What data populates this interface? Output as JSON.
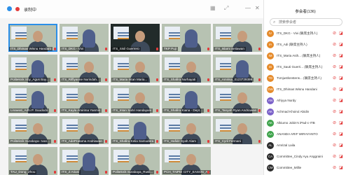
{
  "window": {
    "title": "录制中",
    "minimize": "—",
    "close": "✕"
  },
  "panel": {
    "title": "参会者(136)",
    "search_placeholder": "搜索参会者"
  },
  "tiles": [
    {
      "name": "ITS_Dhimas Wisnu Handani"
    },
    {
      "name": "ITS_DKG - Vivi"
    },
    {
      "name": "ITS_Sisil Guerrero"
    },
    {
      "name": "TKP Puji"
    },
    {
      "name": "ITS_Islami Setiawan"
    },
    {
      "name": "Politeknik Sby_Agus Bay..."
    },
    {
      "name": "ITS_Riffiyanne Nurindah..."
    },
    {
      "name": "ITS_Maria Intan Maria..."
    },
    {
      "name": "ITS_Shafira Nurhayati"
    },
    {
      "name": "ITS_Amirisa_0123729399"
    },
    {
      "name": "Linawati_Adhi P. Suudodo"
    },
    {
      "name": "ITS_Kayla Amirima Yasmin"
    },
    {
      "name": "ITS_Intan Sahri Handayani"
    },
    {
      "name": "ITS_Shafira Kiana - Dept..."
    },
    {
      "name": "ITS_Tanyah Ryan Andriawan"
    },
    {
      "name": "Politeknik Surabaya- Ivan..."
    },
    {
      "name": "ITS_AdePratama Andriawan"
    },
    {
      "name": "ITS_Shafira Kelia Samudera"
    },
    {
      "name": "ITS_Hafidz Syah Alam"
    },
    {
      "name": "ITS_Cyril Fermani"
    },
    {
      "name": "TAU_Dong_Zhou"
    },
    {
      "name": "ITS_Z Ariani"
    },
    {
      "name": "Politeknik Surabaya_Rusli..."
    },
    {
      "name": "PCH_TAIPEI CITY_EASON_A..."
    }
  ],
  "participants": [
    {
      "initials": "IV",
      "name": "ITS_DKG - Vivi (联席主持人)",
      "color": "#e58a2a"
    },
    {
      "initials": "IA",
      "name": "ITS_Adi (联席主持人)",
      "color": "#e58a2a"
    },
    {
      "initials": "IM",
      "name": "ITS_Maria Asih... (联席主持人)",
      "color": "#e58a2a"
    },
    {
      "initials": "IS",
      "name": "ITS_Sauti Guerri... (联席主持人)",
      "color": "#e58a2a"
    },
    {
      "initials": "TD",
      "name": "TUnjustlonstens... (联席主持人)",
      "color": "#e58a2a"
    },
    {
      "initials": "DW",
      "name": "ITS_Dhimas Wisnu Handani",
      "color": "#e58a2a"
    },
    {
      "initials": "AN",
      "name": "Afriyya Nurdy",
      "color": "#7b61c9"
    },
    {
      "initials": "AK",
      "name": "Achmad Khoirul Abidin",
      "color": "#7b61c9"
    },
    {
      "initials": "AK",
      "name": "Alkiumo Jobin's iPad-c-ITB",
      "color": "#3ea34b"
    },
    {
      "initials": "AA",
      "name": "ANANDA ARIF WIRAYANTO",
      "color": "#3ea34b"
    },
    {
      "initials": "AL",
      "name": "Amrizal Laila",
      "color": "#2b2b2b"
    },
    {
      "initials": "CA",
      "name": "Committee_Cindy Ayu Anggraini",
      "color": "#2b2b2b"
    },
    {
      "initials": "CM",
      "name": "Committee_Millie",
      "color": "#2b2b2b"
    }
  ]
}
